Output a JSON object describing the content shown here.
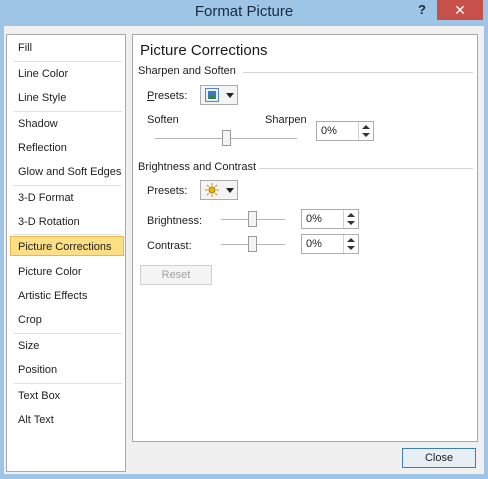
{
  "window": {
    "title": "Format Picture",
    "help_glyph": "?",
    "close_glyph": "✕"
  },
  "nav": {
    "items": [
      {
        "label": "Fill"
      },
      {
        "label": "Line Color"
      },
      {
        "label": "Line Style"
      },
      {
        "label": "Shadow"
      },
      {
        "label": "Reflection"
      },
      {
        "label": "Glow and Soft Edges"
      },
      {
        "label": "3-D Format"
      },
      {
        "label": "3-D Rotation"
      },
      {
        "label": "Picture Corrections"
      },
      {
        "label": "Picture Color"
      },
      {
        "label": "Artistic Effects"
      },
      {
        "label": "Crop"
      },
      {
        "label": "Size"
      },
      {
        "label": "Position"
      },
      {
        "label": "Text Box"
      },
      {
        "label": "Alt Text"
      }
    ],
    "selected": "Picture Corrections"
  },
  "panel": {
    "title": "Picture Corrections",
    "sharpen": {
      "header": "Sharpen and Soften",
      "presets_label": "Presets:",
      "soften_label": "Soften",
      "sharpen_label": "Sharpen",
      "value": "0%",
      "level_percent": 0
    },
    "brightness_contrast": {
      "header": "Brightness and Contrast",
      "presets_label": "Presets:",
      "brightness_label": "Brightness:",
      "brightness_value": "0%",
      "contrast_label": "Contrast:",
      "contrast_value": "0%"
    },
    "reset_label": "Reset"
  },
  "footer": {
    "close_label": "Close"
  },
  "colors": {
    "title_bar": "#9ec4e6",
    "close_button": "#c7504a",
    "selected_item": "#fcdf84",
    "selected_border": "#e6b94a"
  }
}
